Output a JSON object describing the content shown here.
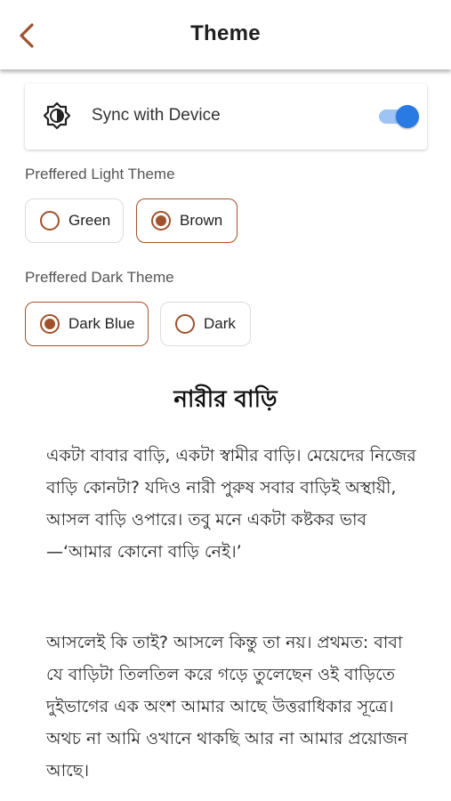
{
  "header": {
    "title": "Theme",
    "back_icon": "chevron-left-icon",
    "accent_color": "#a0522d"
  },
  "sync": {
    "label": "Sync with Device",
    "icon": "brightness-auto-icon",
    "enabled": true,
    "toggle_color": "#2a7ae4"
  },
  "light_theme": {
    "label": "Preffered Light Theme",
    "options": [
      {
        "label": "Green",
        "selected": false
      },
      {
        "label": "Brown",
        "selected": true
      }
    ]
  },
  "dark_theme": {
    "label": "Preffered Dark Theme",
    "options": [
      {
        "label": "Dark Blue",
        "selected": true
      },
      {
        "label": "Dark",
        "selected": false
      }
    ]
  },
  "article": {
    "title": "নারীর বাড়ি",
    "paragraphs": [
      "একটা বাবার বাড়ি, একটা স্বামীর বাড়ি। মেয়েদের নিজের বাড়ি কোনটা? যদিও নারী পুরুষ সবার বাড়িই অস্থায়ী, আসল বাড়ি ওপারে। তবু মনে একটা কষ্টকর ভাব—‘আমার কোনো বাড়ি নেই।’",
      "আসলেই কি তাই? আসলে কিন্তু তা নয়। প্রথমত: বাবা যে বাড়িটা তিলতিল করে গড়ে তুলেছেন ওই বাড়িতে দুইভাগের এক অংশ আমার আছে উত্তরাধিকার সূত্রে। অথচ না আমি ওখানে থাকছি আর না আমার প্রয়োজন আছে।"
    ]
  }
}
